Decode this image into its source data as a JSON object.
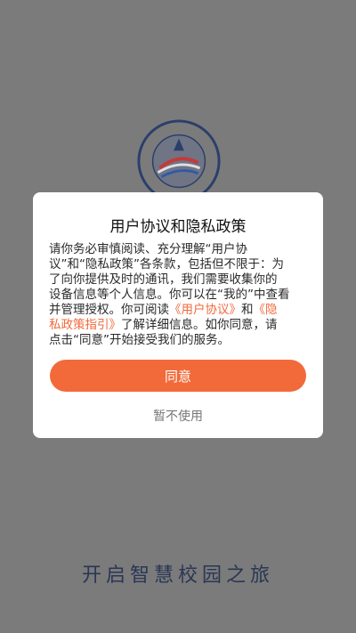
{
  "dialog": {
    "title": "用户协议和隐私政策",
    "body_lines": [
      [
        "请你务必审慎阅读、充分理解“用户协"
      ],
      [
        "议”和“隐私政策”各条款，包括但不限于：为"
      ],
      [
        "了向你提供及时的通讯，我们需要收集你的"
      ],
      [
        "设备信息等个人信息。你可以在“我的”中查看"
      ],
      [
        "并管理授权。你可阅读",
        "《用户协议》",
        "和",
        "《隐"
      ],
      [
        "私政策指引》",
        "了解详细信息。如你同意，请"
      ],
      [
        "点击“同意”开始接受我们的服务。"
      ]
    ],
    "agree_label": "同意",
    "decline_label": "暂不使用"
  },
  "slogan": "开启智慧校园之旅",
  "colors": {
    "overlay": "#7b7b7b",
    "accent": "#f26a3a",
    "link": "#f06a3d",
    "slogan": "#2a3654"
  },
  "icons": {
    "logo": "school-emblem-icon"
  }
}
